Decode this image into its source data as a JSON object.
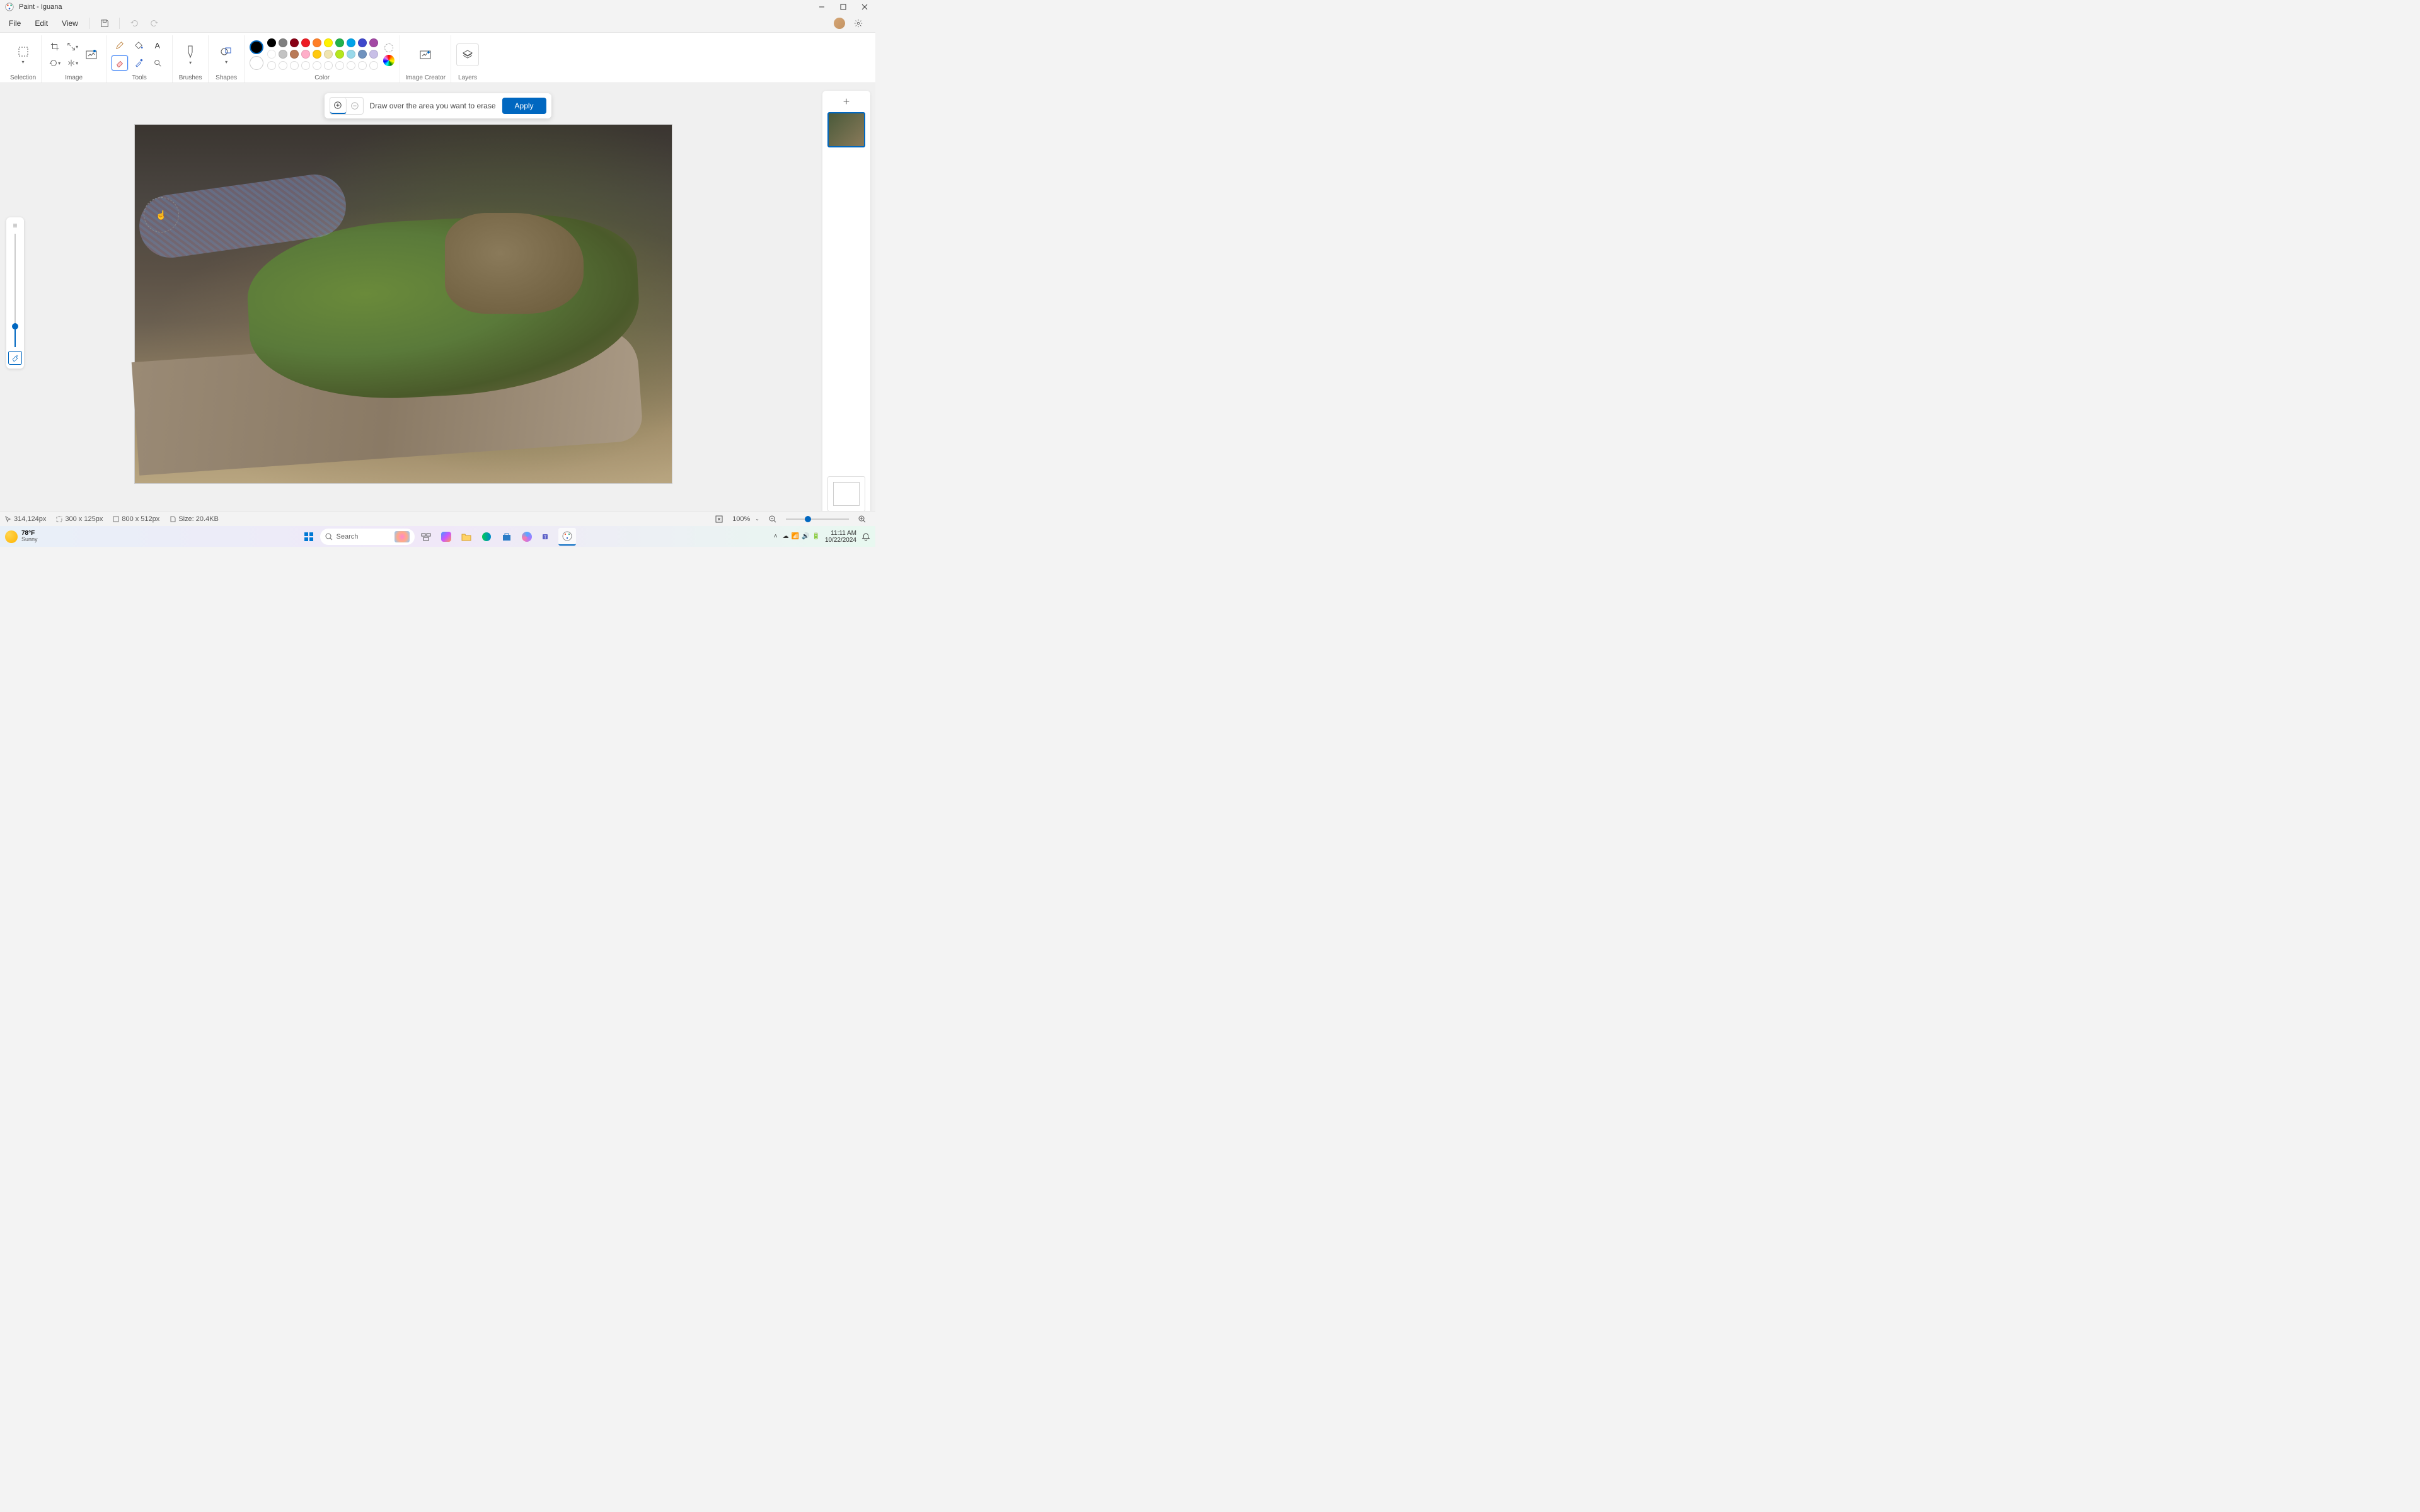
{
  "titlebar": {
    "title": "Paint - Iguana"
  },
  "menu": {
    "file": "File",
    "edit": "Edit",
    "view": "View"
  },
  "ribbon": {
    "selection": "Selection",
    "image": "Image",
    "tools": "Tools",
    "brushes": "Brushes",
    "shapes": "Shapes",
    "color": "Color",
    "image_creator": "Image Creator",
    "layers": "Layers"
  },
  "colors": {
    "primary": "#000000",
    "secondary": "#ffffff",
    "row1": [
      "#000000",
      "#7f7f7f",
      "#880015",
      "#ed1c24",
      "#ff7f27",
      "#fff200",
      "#22b14c",
      "#00a2e8",
      "#3f48cc",
      "#a349a4"
    ],
    "row2": [
      "#ffffff",
      "#c3c3c3",
      "#b97a57",
      "#ffaec9",
      "#ffc90e",
      "#efe4b0",
      "#b5e61d",
      "#99d9ea",
      "#7092be",
      "#c8bfe7"
    ]
  },
  "gen": {
    "hint": "Draw over the area you want to erase",
    "apply": "Apply"
  },
  "status": {
    "pos": "314,124px",
    "sel": "300  x  125px",
    "canvas": "800  x  512px",
    "size": "Size: 20.4KB",
    "zoom": "100%"
  },
  "taskbar": {
    "temp": "78°F",
    "weather": "Sunny",
    "search": "Search",
    "time": "11:11 AM",
    "date": "10/22/2024"
  }
}
